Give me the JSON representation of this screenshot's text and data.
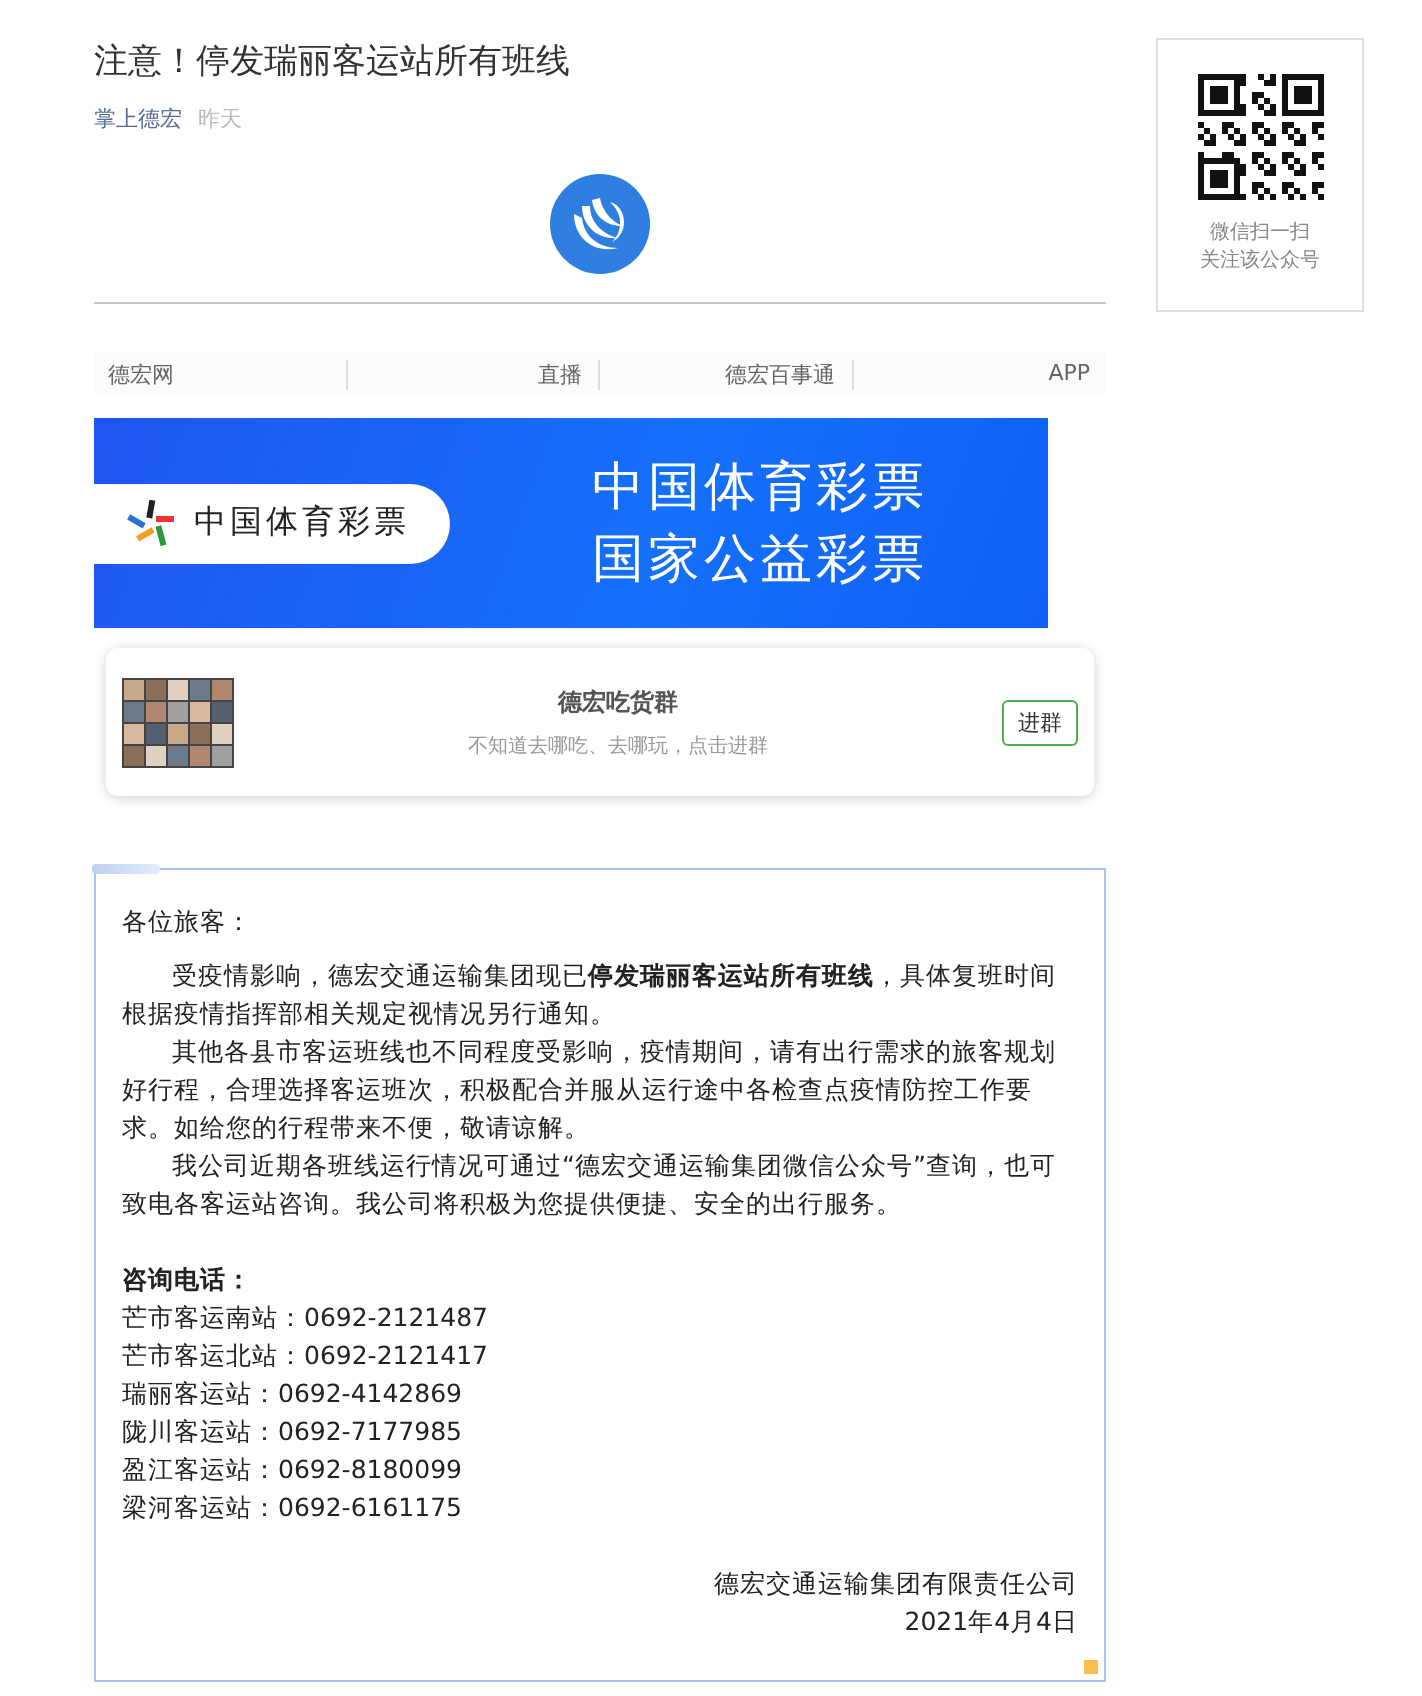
{
  "article": {
    "title": "注意！停发瑞丽客运站所有班线",
    "source": "掌上德宏",
    "time": "昨天"
  },
  "qr_card": {
    "lines": [
      "微信扫一扫",
      "关注该公众号"
    ]
  },
  "nav": [
    {
      "label": "德宏网"
    },
    {
      "label": "直播"
    },
    {
      "label": "德宏百事通"
    },
    {
      "label": "APP"
    }
  ],
  "banner": {
    "brand": "中国体育彩票",
    "headline": [
      "中国体育彩票",
      "国家公益彩票"
    ]
  },
  "group_card": {
    "name": "德宏吃货群",
    "description": "不知道去哪吃、去哪玩，点击进群",
    "button": "进群"
  },
  "notice": {
    "greeting": "各位旅客：",
    "paragraphs": [
      "受疫情影响，德宏交通运输集团现已**停发瑞丽客运站所有班线**，具体复班时间根据疫情指挥部相关规定视情况另行通知。",
      "其他各县市客运班线也不同程度受影响，疫情期间，请有出行需求的旅客规划好行程，合理选择客运班次，积极配合并服从运行途中各检查点疫情防控工作要求。如给您的行程带来不便，敬请谅解。",
      "我公司近期各班线运行情况可通过“德宏交通运输集团微信公众号”查询，也可致电各客运站咨询。我公司将积极为您提供便捷、安全的出行服务。"
    ],
    "contact_heading": "咨询电话：",
    "contacts": [
      "芒市客运南站：0692-2121487",
      "芒市客运北站：0692-2121417",
      "瑞丽客运站：0692-4142869",
      "陇川客运站：0692-7177985",
      "盈江客运站：0692-8180099",
      "梁河客运站：0692-6161175"
    ],
    "signature": "德宏交通运输集团有限责任公司",
    "date": "2021年4月4日"
  }
}
